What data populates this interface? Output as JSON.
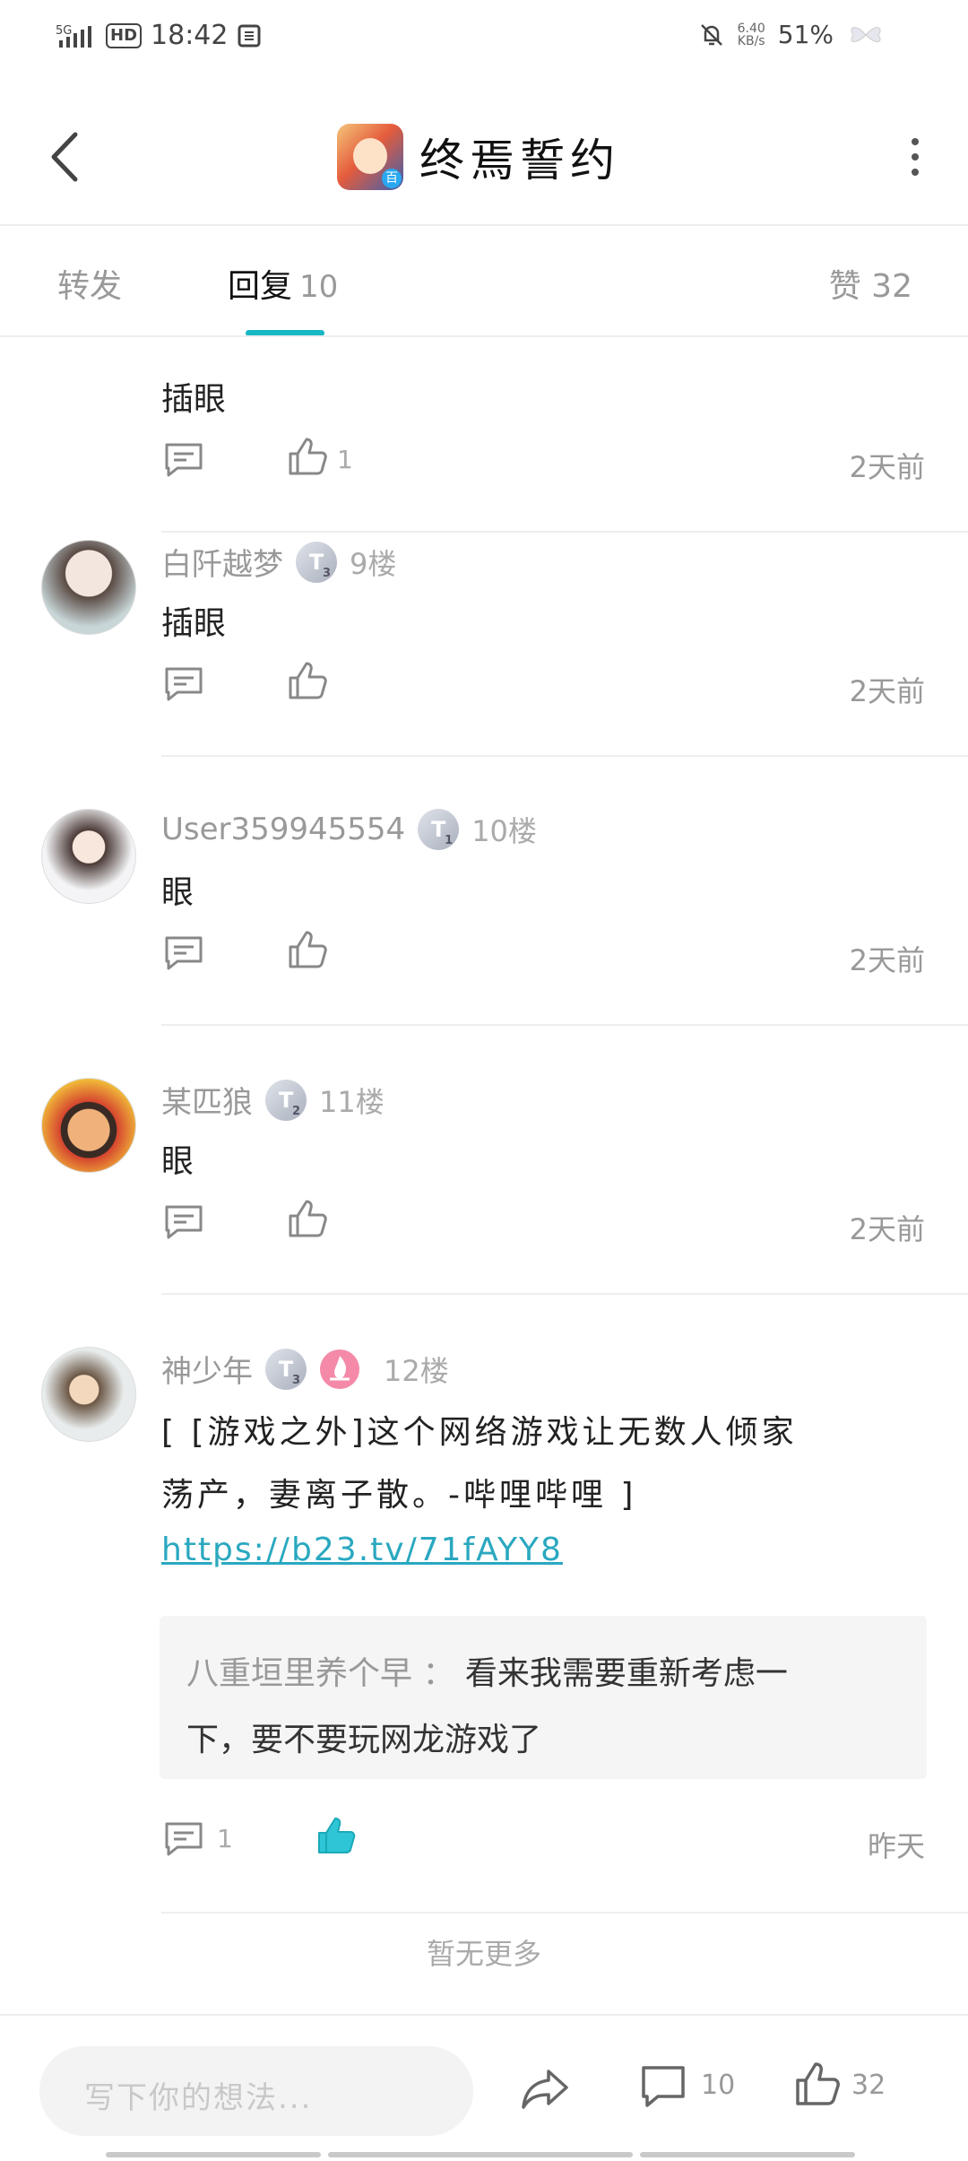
{
  "status_bar": {
    "network": "5G",
    "hd": "HD",
    "time": "18:42",
    "speed_value": "6.40",
    "speed_unit": "KB/s",
    "battery": "51%"
  },
  "header": {
    "title": "终焉誓约",
    "app_icon_badge": "百"
  },
  "tabs": {
    "repost": "转发",
    "reply": "回复",
    "reply_count": "10",
    "like": "赞 32"
  },
  "comments": [
    {
      "name": "",
      "content": "插眼",
      "reply_count": "",
      "like_count": "1",
      "time": "2天前"
    },
    {
      "name": "白阡越梦",
      "badge": "T",
      "level": "3",
      "floor": "9楼",
      "content": "插眼",
      "reply_count": "",
      "like_count": "",
      "time": "2天前"
    },
    {
      "name": "User359945554",
      "badge": "T",
      "level": "1",
      "floor": "10楼",
      "content": "眼",
      "reply_count": "",
      "like_count": "",
      "time": "2天前"
    },
    {
      "name": "某匹狼",
      "badge": "T",
      "level": "2",
      "floor": "11楼",
      "content": "眼",
      "reply_count": "",
      "like_count": "",
      "time": "2天前"
    },
    {
      "name": "神少年",
      "badge": "T",
      "level": "3",
      "floor": "12楼",
      "content_line1": "[ [游戏之外]这个网络游戏让无数人倾家",
      "content_line2": "荡产，妻离子散。-哔哩哔哩 ]",
      "link": "https://b23.tv/71fAYY8",
      "quote_name": "八重垣里养个早 ：",
      "quote_text_1": "看来我需要重新考虑一",
      "quote_text_2": "下，要不要玩网龙游戏了",
      "reply_count": "1",
      "like_count": "",
      "time": "昨天"
    }
  ],
  "end_note": "暂无更多",
  "bottom_bar": {
    "input_placeholder": "写下你的想法...",
    "comment_count": "10",
    "like_count": "32"
  },
  "colors": {
    "accent": "#17b8c4",
    "link": "#2aa8c0",
    "liked": "#2ec5d6"
  }
}
